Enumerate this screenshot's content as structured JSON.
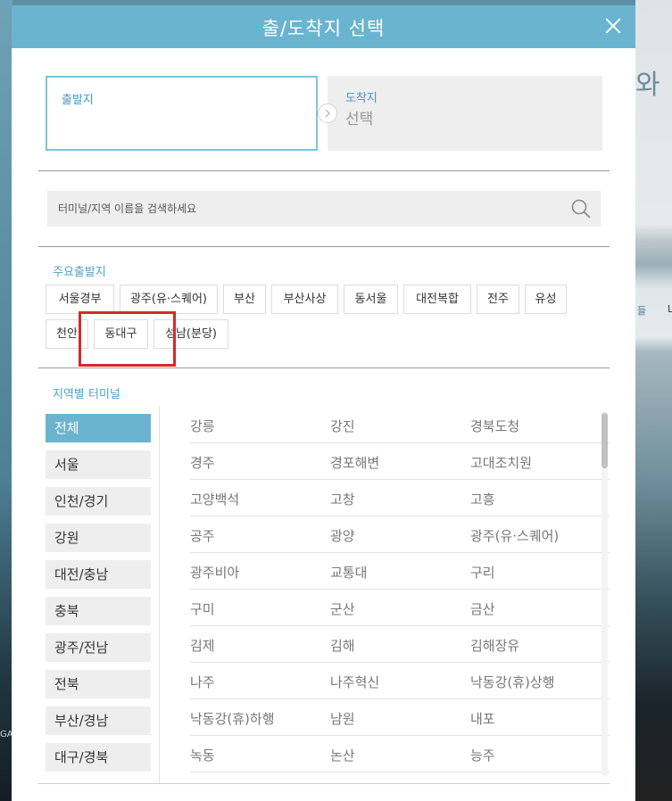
{
  "background": {
    "right_heading": "와",
    "right_small_a": "들",
    "right_small_b": "L",
    "left_text": "GA"
  },
  "modal": {
    "title": "출/도착지 선택",
    "from_label": "출발지",
    "to_label": "도착지",
    "to_value": "선택",
    "search_placeholder": "터미널/지역 이름을 검색하세요",
    "major_title": "주요출발지",
    "major_chips": [
      "서울경부",
      "광주(유·스퀘어)",
      "부산",
      "부산사상",
      "동서울",
      "대전복합",
      "전주",
      "유성",
      "천안",
      "동대구",
      "성남(분당)"
    ],
    "region_title": "지역별 터미널",
    "regions": [
      "전체",
      "서울",
      "인천/경기",
      "강원",
      "대전/충남",
      "충북",
      "광주/전남",
      "전북",
      "부산/경남",
      "대구/경북"
    ],
    "active_region": "전체",
    "terminals": [
      [
        "강릉",
        "강진",
        "경북도청"
      ],
      [
        "경주",
        "경포해변",
        "고대조치원"
      ],
      [
        "고양백석",
        "고창",
        "고흥"
      ],
      [
        "공주",
        "광양",
        "광주(유·스퀘어)"
      ],
      [
        "광주비아",
        "교통대",
        "구리"
      ],
      [
        "구미",
        "군산",
        "금산"
      ],
      [
        "김제",
        "김해",
        "김해장유"
      ],
      [
        "나주",
        "나주혁신",
        "낙동강(휴)상행"
      ],
      [
        "낙동강(휴)하행",
        "남원",
        "내포"
      ],
      [
        "녹동",
        "논산",
        "능주"
      ]
    ]
  },
  "colors": {
    "header": "#6ab4cf",
    "accent_text": "#4da3c8",
    "highlight_box": "#d42a2a"
  },
  "icons": {
    "close": "close-icon",
    "search": "search-icon",
    "arrow": "arrow-right-icon"
  }
}
